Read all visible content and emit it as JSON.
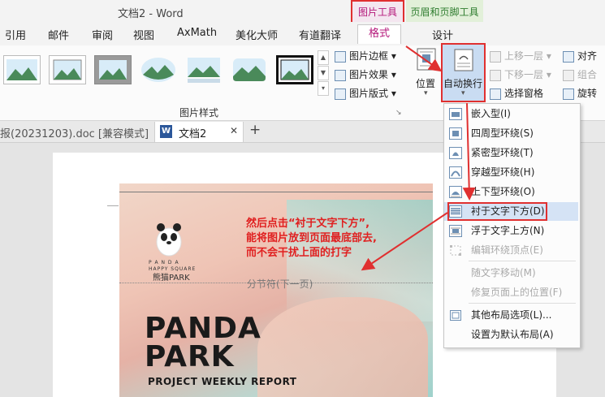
{
  "window": {
    "title": "文档2 - Word"
  },
  "context_tabs": {
    "picture_tools": "图片工具",
    "header_footer_tools": "页眉和页脚工具"
  },
  "tabs": [
    "引用",
    "邮件",
    "审阅",
    "视图",
    "AxMath",
    "美化大师",
    "有道翻译"
  ],
  "context_subtabs": {
    "format": "格式",
    "design": "设计"
  },
  "ribbon": {
    "group_picture_styles": "图片样式",
    "picture_border": "图片边框",
    "picture_effects": "图片效果",
    "picture_layout": "图片版式",
    "position": "位置",
    "wrap_text": "自动换行",
    "bring_forward": "上移一层",
    "send_backward": "下移一层",
    "selection_pane": "选择窗格",
    "align": "对齐",
    "group": "组合",
    "rotate": "旋转"
  },
  "doc_tabs": {
    "previous": "报(20231203).doc [兼容模式]",
    "current": "文档2",
    "close": "✕",
    "add": "+"
  },
  "document": {
    "section_break": "分节符(下一页)",
    "brand_line1": "P A N D A",
    "brand_line2": "HAPPY SQUARE",
    "brand_line3": "熊猫PARK",
    "headline1": "PANDA",
    "headline2": "PARK",
    "subtitle": "PROJECT WEEKLY REPORT"
  },
  "annotation": {
    "line1": "然后点击“衬于文字下方”,",
    "line2": "能将图片放到页面最底部去,",
    "line3": "而不会干扰上面的打字"
  },
  "wrap_menu": {
    "items": [
      {
        "label": "嵌入型(I)",
        "enabled": true,
        "icon": "inline-wrap-icon"
      },
      {
        "label": "四周型环绕(S)",
        "enabled": true,
        "icon": "square-wrap-icon"
      },
      {
        "label": "紧密型环绕(T)",
        "enabled": true,
        "icon": "tight-wrap-icon"
      },
      {
        "label": "穿越型环绕(H)",
        "enabled": true,
        "icon": "through-wrap-icon"
      },
      {
        "label": "上下型环绕(O)",
        "enabled": true,
        "icon": "top-bottom-wrap-icon"
      },
      {
        "label": "衬于文字下方(D)",
        "enabled": true,
        "icon": "behind-text-icon",
        "highlighted": true
      },
      {
        "label": "浮于文字上方(N)",
        "enabled": true,
        "icon": "in-front-text-icon"
      },
      {
        "label": "编辑环绕顶点(E)",
        "enabled": false,
        "icon": "edit-wrap-points-icon"
      },
      {
        "label": "随文字移动(M)",
        "enabled": false
      },
      {
        "label": "修复页面上的位置(F)",
        "enabled": false
      },
      {
        "label": "其他布局选项(L)...",
        "enabled": true,
        "icon": "layout-options-icon"
      },
      {
        "label": "设置为默认布局(A)",
        "enabled": true
      }
    ]
  },
  "colors": {
    "accent_red": "#e03030",
    "picture_tools_magenta": "#b4167a",
    "hf_green": "#2f7d2f"
  }
}
